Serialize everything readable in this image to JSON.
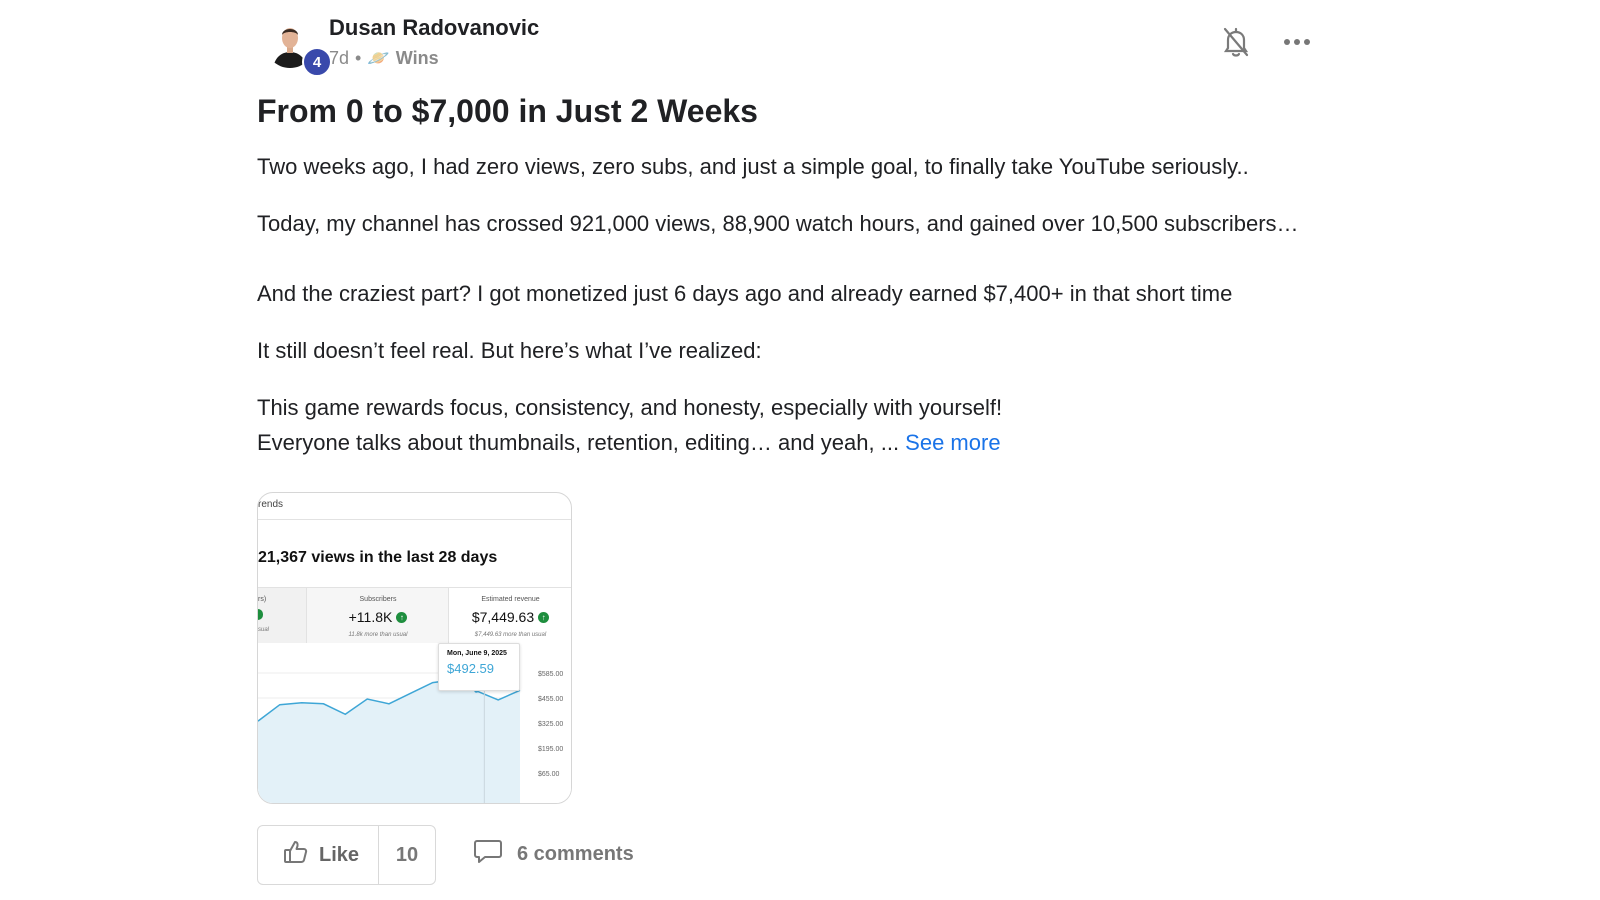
{
  "post": {
    "author": "Dusan Radovanovic",
    "level": "4",
    "time": "7d",
    "separator": "•",
    "category_icon": "🪐",
    "category": "Wins",
    "title": "From 0 to $7,000 in Just 2 Weeks",
    "paragraphs": {
      "p1": "Two weeks ago, I had zero views, zero subs, and just a simple goal, to finally take YouTube seriously..",
      "p2a": "Today, my channel has crossed 921,000 views, 88,900 watch hours, and gained over 10,500 subscribers…",
      "p2b": "And the craziest part? I got monetized just 6 days ago and already earned $7,400+ in that short time",
      "p3": "It still doesn’t feel real. But here’s what I’ve realized:",
      "p4a": "This game rewards focus, consistency, and honesty, especially with yourself!",
      "p4b": "Everyone talks about thumbnails, retention, editing… and yeah, ... "
    },
    "see_more": "See more"
  },
  "image": {
    "tab": "rends",
    "headline": "21,367 views in the last 28 days",
    "stat0": {
      "label": "rs)",
      "sub": "sual"
    },
    "stat1": {
      "label": "Subscribers",
      "value": "+11.8K",
      "sub": "11.8k more than usual"
    },
    "stat2": {
      "label": "Estimated revenue",
      "value": "$7,449.63",
      "sub": "$7,449.63 more than usual"
    },
    "tooltip": {
      "date": "Mon, June 9, 2025",
      "value": "$492.59"
    }
  },
  "chart_data": {
    "type": "area",
    "yticks": [
      "$585.00",
      "$455.00",
      "$325.00",
      "$195.00",
      "$65.00"
    ],
    "ylim": [
      65,
      585
    ],
    "values": [
      335,
      420,
      430,
      425,
      370,
      450,
      425,
      480,
      535,
      550,
      492.59,
      445,
      495
    ],
    "highlight_index": 10,
    "color": "#3ea6d6"
  },
  "actions": {
    "like_label": "Like",
    "like_count": "10",
    "comments_label": "6 comments"
  },
  "colors": {
    "accent": "#1a73e8",
    "badge": "#3949ab",
    "positive": "#1e8e3e"
  }
}
